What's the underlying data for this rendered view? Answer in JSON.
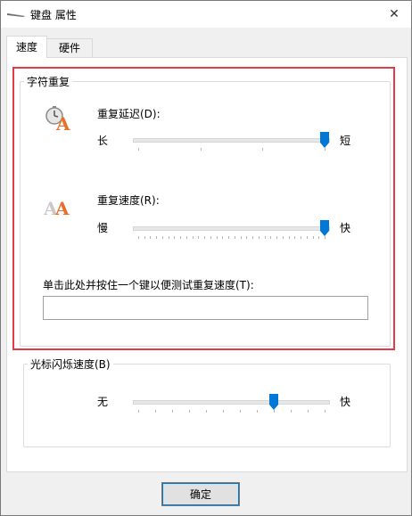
{
  "window": {
    "title": "键盘 属性",
    "close_glyph": "✕"
  },
  "tabs": [
    {
      "label": "速度",
      "active": true
    },
    {
      "label": "硬件",
      "active": false
    }
  ],
  "character_repeat": {
    "legend": "字符重复",
    "repeat_delay": {
      "label": "重复延迟(D):",
      "min_label": "长",
      "max_label": "短",
      "ticks": 4,
      "value": 3,
      "max": 3
    },
    "repeat_rate": {
      "label": "重复速度(R):",
      "min_label": "慢",
      "max_label": "快",
      "ticks": 32,
      "value": 31,
      "max": 31
    },
    "test": {
      "label": "单击此处并按住一个键以便测试重复速度(T):",
      "value": ""
    }
  },
  "cursor_blink": {
    "legend": "光标闪烁速度(B)",
    "min_label": "无",
    "max_label": "快",
    "ticks": 12,
    "value": 8,
    "max": 11
  },
  "footer": {
    "ok_label": "确定"
  },
  "colors": {
    "highlight": "#e53b46",
    "accent": "#0078d7",
    "icon_orange": "#e8702a"
  },
  "icons": {
    "title": "keyboard-icon",
    "close": "close-icon",
    "repeat_delay": "repeat-delay-icon",
    "repeat_rate": "repeat-rate-icon"
  }
}
